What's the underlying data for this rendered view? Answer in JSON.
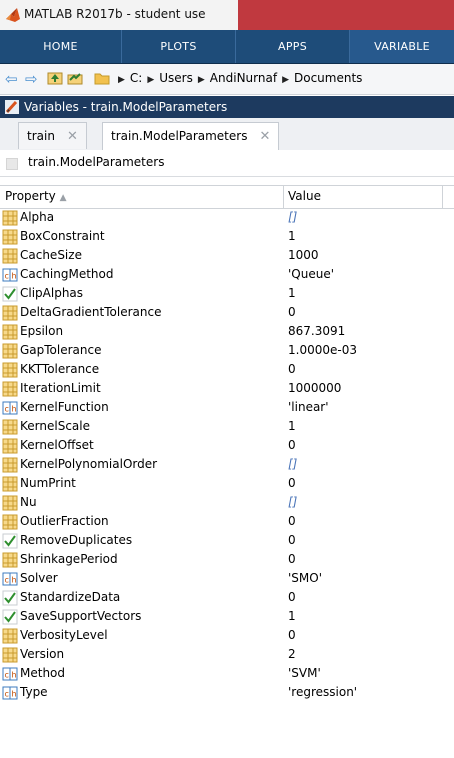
{
  "app": {
    "title": "MATLAB R2017b - student use"
  },
  "toolstrip": {
    "tabs": [
      "HOME",
      "PLOTS",
      "APPS",
      "VARIABLE"
    ],
    "active_tab": "VARIABLE"
  },
  "address": {
    "crumbs": [
      "C:",
      "Users",
      "AndiNurnaf",
      "Documents"
    ]
  },
  "variables_panel": {
    "title": "Variables - train.ModelParameters",
    "tabs": [
      {
        "label": "train",
        "active": false
      },
      {
        "label": "train.ModelParameters",
        "active": true
      }
    ],
    "path": "train.ModelParameters"
  },
  "table": {
    "columns": [
      "Property",
      "Value"
    ],
    "sort_indicator": "▲",
    "rows": [
      {
        "icon": "numeric-icon",
        "name": "Alpha",
        "value": "[]"
      },
      {
        "icon": "numeric-icon",
        "name": "BoxConstraint",
        "value": "1"
      },
      {
        "icon": "numeric-icon",
        "name": "CacheSize",
        "value": "1000"
      },
      {
        "icon": "char-icon",
        "name": "CachingMethod",
        "value": "'Queue'"
      },
      {
        "icon": "check-icon",
        "name": "ClipAlphas",
        "value": "1"
      },
      {
        "icon": "numeric-icon",
        "name": "DeltaGradientTolerance",
        "value": "0"
      },
      {
        "icon": "numeric-icon",
        "name": "Epsilon",
        "value": "867.3091"
      },
      {
        "icon": "numeric-icon",
        "name": "GapTolerance",
        "value": "1.0000e-03"
      },
      {
        "icon": "numeric-icon",
        "name": "KKTTolerance",
        "value": "0"
      },
      {
        "icon": "numeric-icon",
        "name": "IterationLimit",
        "value": "1000000"
      },
      {
        "icon": "char-icon",
        "name": "KernelFunction",
        "value": "'linear'"
      },
      {
        "icon": "numeric-icon",
        "name": "KernelScale",
        "value": "1"
      },
      {
        "icon": "numeric-icon",
        "name": "KernelOffset",
        "value": "0"
      },
      {
        "icon": "numeric-icon",
        "name": "KernelPolynomialOrder",
        "value": "[]"
      },
      {
        "icon": "numeric-icon",
        "name": "NumPrint",
        "value": "0"
      },
      {
        "icon": "numeric-icon",
        "name": "Nu",
        "value": "[]"
      },
      {
        "icon": "numeric-icon",
        "name": "OutlierFraction",
        "value": "0"
      },
      {
        "icon": "check-icon",
        "name": "RemoveDuplicates",
        "value": "0"
      },
      {
        "icon": "numeric-icon",
        "name": "ShrinkagePeriod",
        "value": "0"
      },
      {
        "icon": "char-icon",
        "name": "Solver",
        "value": "'SMO'"
      },
      {
        "icon": "check-icon",
        "name": "StandardizeData",
        "value": "0"
      },
      {
        "icon": "check-icon",
        "name": "SaveSupportVectors",
        "value": "1"
      },
      {
        "icon": "numeric-icon",
        "name": "VerbosityLevel",
        "value": "0"
      },
      {
        "icon": "numeric-icon",
        "name": "Version",
        "value": "2"
      },
      {
        "icon": "char-icon",
        "name": "Method",
        "value": "'SVM'"
      },
      {
        "icon": "char-icon",
        "name": "Type",
        "value": "'regression'"
      }
    ]
  },
  "colors": {
    "toolstrip_bg": "#1e4c79",
    "titlebar_accent": "#c0393f",
    "variables_header": "#1d3a5f",
    "empty_value": "#4a74b8"
  }
}
